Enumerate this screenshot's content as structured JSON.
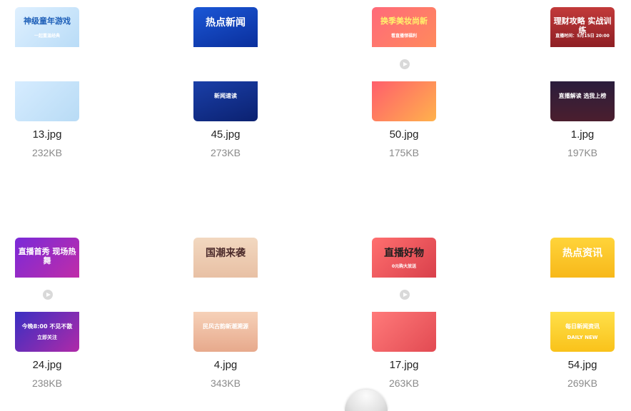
{
  "files": [
    {
      "name": "13.jpg",
      "size": "232KB",
      "top_text": "神级童年游戏",
      "top_sub": "一起重温经典",
      "bottom_text": "",
      "top_bg": "linear-gradient(135deg,#dff0ff,#b9dcf7)",
      "top_color": "#1e5fb8",
      "bottom_bg": "linear-gradient(135deg,#d6ecff,#b8dbf5)",
      "icon": "media-controls-icon"
    },
    {
      "name": "45.jpg",
      "size": "273KB",
      "top_text": "热点新闻",
      "top_sub": "",
      "bottom_text": "新闻速读",
      "top_bg": "linear-gradient(160deg,#1b57d6,#0a2f9c)",
      "top_color": "#ffffff",
      "bottom_bg": "linear-gradient(160deg,#1a3fa8,#0b2170)",
      "icon": "megaphone-icon"
    },
    {
      "name": "50.jpg",
      "size": "175KB",
      "top_text": "换季美妆尚新",
      "top_sub": "看直播领福利",
      "bottom_text": "",
      "top_bg": "linear-gradient(135deg,#ff6a7a,#ff8a5c)",
      "top_color": "#fff36b",
      "bottom_bg": "linear-gradient(135deg,#ff5e6c,#ffb24c)",
      "icon": "portrait-icon"
    },
    {
      "name": "1.jpg",
      "size": "197KB",
      "top_text": "理财攻略 实战训练",
      "top_sub": "直播时间：5月15日 20:00",
      "bottom_text": "直播解读 选我上榜",
      "top_bg": "linear-gradient(180deg,#c23a3a,#8e1f24)",
      "top_color": "#ffffff",
      "bottom_bg": "linear-gradient(180deg,#2a1d3c,#4b1e2e)",
      "icon": ""
    },
    {
      "name": "24.jpg",
      "size": "238KB",
      "top_text": "直播首秀 现场热舞",
      "top_sub": "",
      "bottom_text": "今晚8:00 不见不散",
      "bottom_sub": "立即关注",
      "top_bg": "linear-gradient(135deg,#7a2ad8,#c02ca8)",
      "top_color": "#ffffff",
      "bottom_bg": "linear-gradient(135deg,#3a2fc2,#b02aa8)",
      "icon": ""
    },
    {
      "name": "4.jpg",
      "size": "343KB",
      "top_text": "国潮来袭",
      "top_sub": "",
      "bottom_text": "民风古韵新潮溯源",
      "top_bg": "linear-gradient(180deg,#f2d8c0,#e8c0a4)",
      "top_color": "#4b2a2a",
      "bottom_bg": "linear-gradient(180deg,#f6d1b8,#e7a98c)",
      "icon": "crane-icon"
    },
    {
      "name": "17.jpg",
      "size": "263KB",
      "top_text": "直播好物",
      "top_sub": "0元购大放送",
      "bottom_text": "",
      "top_bg": "linear-gradient(135deg,#ff6f6f,#d9404b)",
      "top_color": "#1f1f1f",
      "bottom_bg": "linear-gradient(135deg,#ff7a7a,#e24a52)",
      "icon": "megaphone-icon"
    },
    {
      "name": "54.jpg",
      "size": "269KB",
      "top_text": "热点资讯",
      "top_sub": "",
      "bottom_text": "每日新闻资讯",
      "bottom_sub": "DAILY NEW",
      "top_bg": "linear-gradient(180deg,#ffd43a,#f7b81a)",
      "top_color": "#ffffff",
      "bottom_bg": "linear-gradient(180deg,#ffe04a,#f9c21a)",
      "icon": ""
    }
  ]
}
